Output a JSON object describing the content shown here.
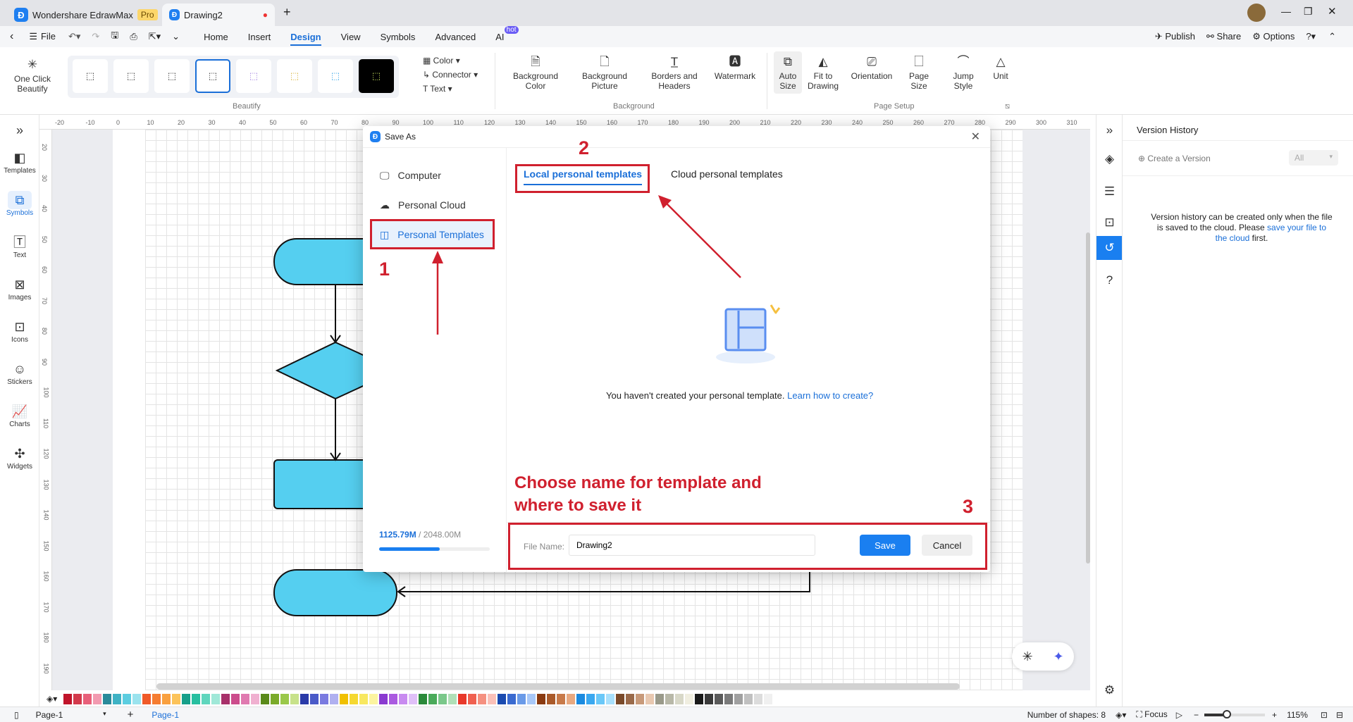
{
  "app": {
    "name": "Wondershare EdrawMax",
    "badge": "Pro",
    "doc_tab": "Drawing2"
  },
  "menu": {
    "file": "File",
    "items": [
      "Home",
      "Insert",
      "Design",
      "View",
      "Symbols",
      "Advanced",
      "AI"
    ],
    "active": "Design",
    "ai_badge": "hot",
    "publish": "Publish",
    "share": "Share",
    "options": "Options"
  },
  "ribbon": {
    "one_click": "One Click Beautify",
    "beautify_group": "Beautify",
    "color": "Color",
    "connector": "Connector",
    "text": "Text",
    "bg_color": "Background Color",
    "bg_picture": "Background Picture",
    "borders": "Borders and Headers",
    "watermark": "Watermark",
    "background_group": "Background",
    "auto_size": "Auto Size",
    "fit": "Fit to Drawing",
    "orientation": "Orientation",
    "page_size": "Page Size",
    "jump_style": "Jump Style",
    "unit": "Unit",
    "page_setup_group": "Page Setup"
  },
  "sidebar": {
    "items": [
      "Templates",
      "Symbols",
      "Text",
      "Images",
      "Icons",
      "Stickers",
      "Charts",
      "Widgets"
    ],
    "active": "Symbols"
  },
  "ruler": {
    "top": [
      "-20",
      "-10",
      "0",
      "10",
      "20",
      "30",
      "40",
      "50",
      "60",
      "70",
      "80",
      "90",
      "100",
      "110",
      "120",
      "130",
      "140",
      "150",
      "160",
      "170",
      "180",
      "190",
      "200",
      "210",
      "220",
      "230",
      "240",
      "250",
      "260",
      "270",
      "280",
      "290",
      "300",
      "310"
    ],
    "left": [
      "20",
      "30",
      "40",
      "50",
      "60",
      "70",
      "80",
      "90",
      "100",
      "110",
      "120",
      "130",
      "140",
      "150",
      "160",
      "170",
      "180",
      "190"
    ]
  },
  "dialog": {
    "title": "Save As",
    "locations": [
      "Computer",
      "Personal Cloud",
      "Personal Templates"
    ],
    "active_location": "Personal Templates",
    "tabs": [
      "Local personal templates",
      "Cloud personal templates"
    ],
    "active_tab": "Local personal templates",
    "empty_text": "You haven't created your personal template.",
    "learn_link": "Learn how to create?",
    "storage_used": "1125.79M",
    "storage_total": " / 2048.00M",
    "storage_fraction": 0.55,
    "file_name_label": "File Name:",
    "file_name_value": "Drawing2",
    "save": "Save",
    "cancel": "Cancel"
  },
  "annotations": {
    "n1": "1",
    "n2": "2",
    "n3": "3",
    "line1": "Choose name for template and",
    "line2": "where to save it"
  },
  "version_panel": {
    "title": "Version History",
    "create": "Create a Version",
    "filter": "All",
    "msg1": "Version history can be created only when the file is saved to the cloud. Please ",
    "msg_link": "save your file to the cloud",
    "msg2": " first."
  },
  "status": {
    "page_select": "Page-1",
    "page_tab": "Page-1",
    "shapes": "Number of shapes: 8",
    "focus": "Focus",
    "zoom": "115%"
  },
  "palette": [
    "#c0142a",
    "#d33a4c",
    "#e8607a",
    "#f29ab0",
    "#2a8a9a",
    "#3fb2c4",
    "#5ccde0",
    "#9be3ee",
    "#f05a28",
    "#f57c30",
    "#f9a03f",
    "#fcc35a",
    "#17a08a",
    "#27bfa0",
    "#5fd6bd",
    "#a0e8d8",
    "#a8306a",
    "#cc4c8c",
    "#e07ab0",
    "#f0b0d0",
    "#5a8a1a",
    "#7aaa2a",
    "#9ac84a",
    "#c8e28a",
    "#2a3aa8",
    "#4a5ac8",
    "#7a7ae0",
    "#b0b0f0",
    "#f0c000",
    "#f5d830",
    "#f8e860",
    "#fcf4a0",
    "#8a3ad0",
    "#aa5ae0",
    "#c88af0",
    "#e0c0f8",
    "#2a8a3a",
    "#4aaa5a",
    "#7ac88a",
    "#b0e0b8",
    "#e8382a",
    "#f06050",
    "#f59080",
    "#fac0b8",
    "#1a4ab0",
    "#3a6ad0",
    "#6a9ae8",
    "#a8c8f8",
    "#8a3a10",
    "#aa5a2a",
    "#c87a4a",
    "#e8a880",
    "#1a8ae0",
    "#3aa8f0",
    "#6ac8f8",
    "#a8e0fc",
    "#7a4a2a",
    "#9a6a4a",
    "#c89a7a",
    "#e8c8b0",
    "#9a9a8a",
    "#b8b8a8",
    "#d8d8c8",
    "#f0eee0",
    "#1a1a1a",
    "#3a3a3a",
    "#5a5a5a",
    "#7a7a7a",
    "#a0a0a0",
    "#c0c0c0",
    "#dcdcdc",
    "#f0f0f0"
  ],
  "colors": {
    "accent": "#1a6fd8",
    "annotation": "#d0202e",
    "shape_fill": "#55cff0"
  }
}
